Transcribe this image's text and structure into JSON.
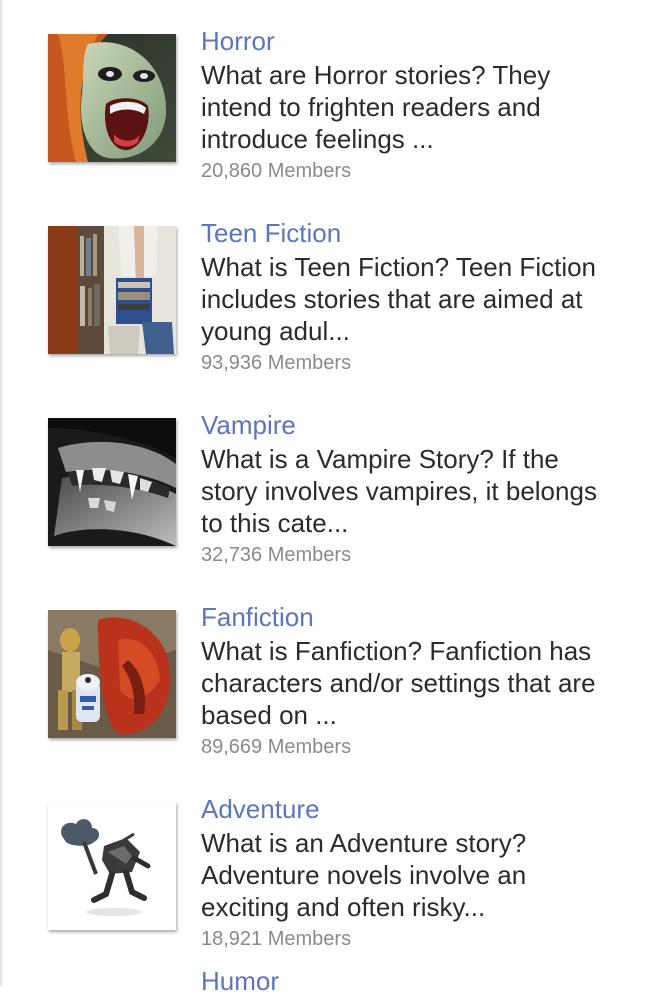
{
  "categories": [
    {
      "title": "Horror",
      "description": "What are Horror stories? They intend to frighten readers and introduce feelings ...",
      "members": "20,860 Members",
      "icon": "screaming-face-icon"
    },
    {
      "title": "Teen Fiction",
      "description": "What is Teen Fiction? Teen Fiction includes stories that are aimed at young adul...",
      "members": "93,936 Members",
      "icon": "student-with-books-icon"
    },
    {
      "title": "Vampire",
      "description": "What is a Vampire Story? If the story involves vampires, it belongs to this cate...",
      "members": "32,736 Members",
      "icon": "vampire-fangs-icon"
    },
    {
      "title": "Fanfiction",
      "description": "What is Fanfiction? Fanfiction has characters and/or settings that are based on ...",
      "members": "89,669 Members",
      "icon": "robots-collage-icon"
    },
    {
      "title": "Adventure",
      "description": "What is an Adventure story? Adventure novels involve an exciting and often risky...",
      "members": "18,921 Members",
      "icon": "running-knight-icon"
    }
  ],
  "partial_next_title": "Humor",
  "colors": {
    "title_link": "#5b75bf",
    "description_text": "#2b2b2b",
    "members_text": "#8a8a8a",
    "background": "#ffffff"
  }
}
